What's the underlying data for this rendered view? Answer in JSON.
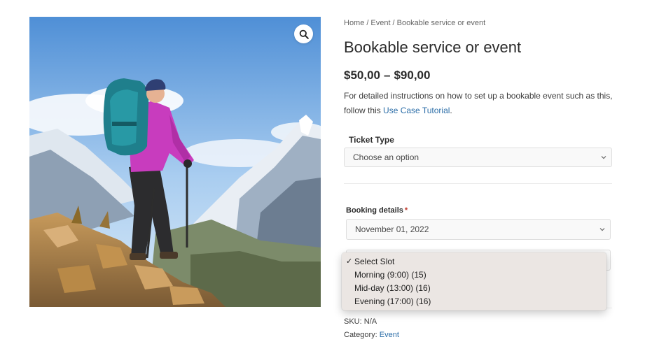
{
  "gallery": {
    "image_alt": "Hiker with backpack on mountain summit",
    "zoom_icon": "magnifier-icon"
  },
  "breadcrumb": {
    "items": [
      "Home",
      "Event",
      "Bookable service or event"
    ],
    "separator": "/"
  },
  "product": {
    "title": "Bookable service or event",
    "price_min": "$50,00",
    "price_sep": "–",
    "price_max": "$90,00",
    "description_text": "For detailed instructions on how to set up a bookable event such as this, follow this ",
    "description_link": "Use Case Tutorial",
    "description_end": "."
  },
  "ticket": {
    "label": "Ticket Type",
    "selected": "Choose an option"
  },
  "booking": {
    "label": "Booking details",
    "required_mark": "*",
    "date_selected": "November 01, 2022",
    "slot_options": [
      {
        "label": "Select Slot",
        "checked": true
      },
      {
        "label": "Morning (9:00) (15)",
        "checked": false
      },
      {
        "label": "Mid-day (13:00) (16)",
        "checked": false
      },
      {
        "label": "Evening (17:00) (16)",
        "checked": false
      }
    ],
    "check_glyph": "✓"
  },
  "meta": {
    "sku_label": "SKU:",
    "sku_value": "N/A",
    "category_label": "Category:",
    "category_value": "Event"
  },
  "colors": {
    "link": "#2c6ea8",
    "required": "#c0392b",
    "dropdown_bg": "#ebe6e3"
  }
}
